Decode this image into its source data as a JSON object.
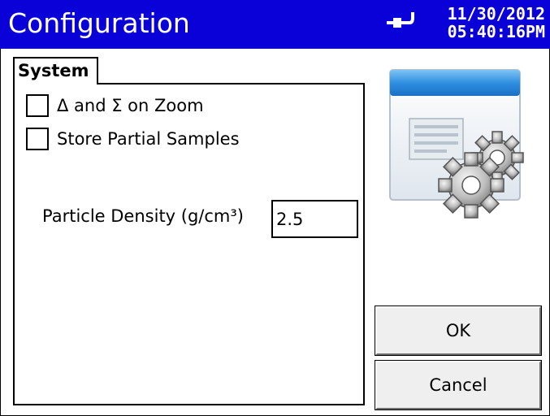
{
  "titlebar": {
    "title": "Configuration",
    "date": "11/30/2012",
    "time": "05:40:16PM",
    "icon": "power-plug-icon",
    "background": "#0a00d8"
  },
  "tab": {
    "label": "System"
  },
  "options": {
    "delta_sigma_label": "Δ and Σ on Zoom",
    "delta_sigma_checked": false,
    "store_partial_label": "Store Partial Samples",
    "store_partial_checked": false
  },
  "density": {
    "label": "Particle Density (g/cm³)",
    "value": "2.5"
  },
  "graphic": {
    "icon": "configuration-gears-icon"
  },
  "buttons": {
    "ok": "OK",
    "cancel": "Cancel"
  }
}
